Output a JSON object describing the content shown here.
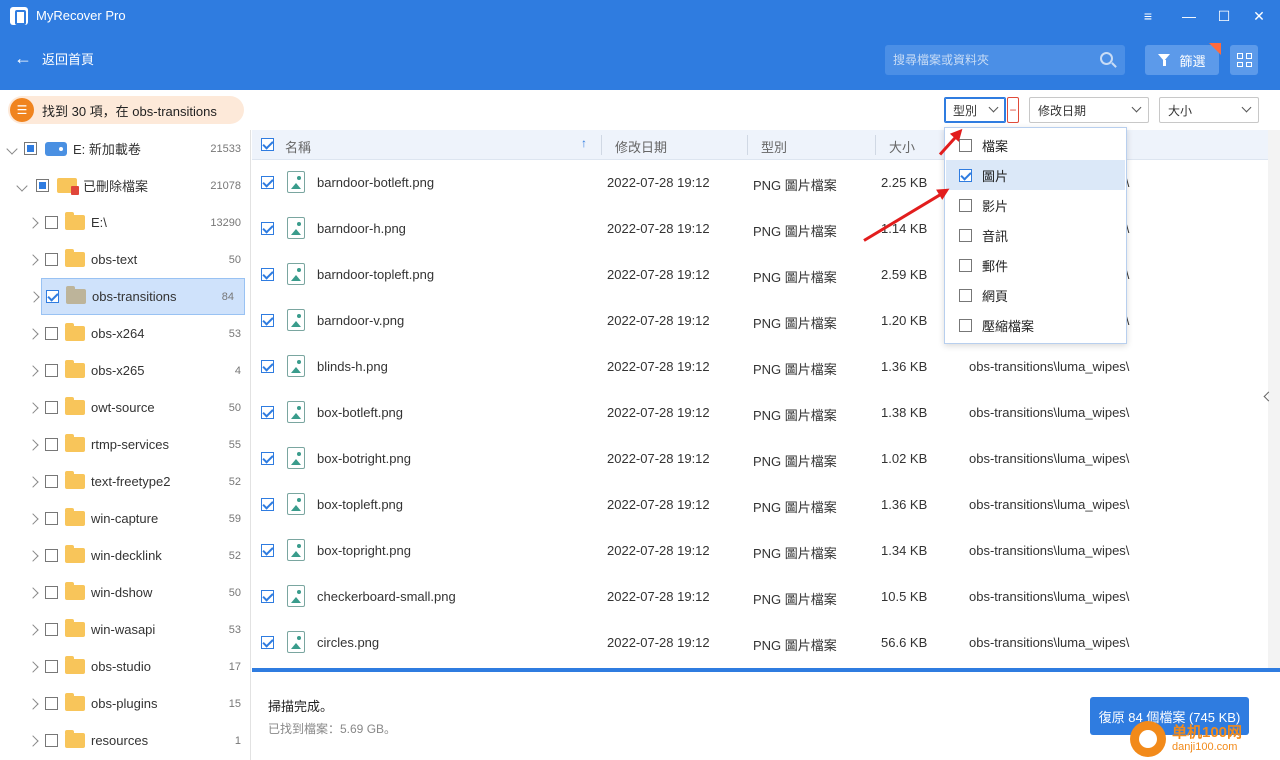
{
  "window": {
    "title": "MyRecover Pro",
    "controls": [
      "≡",
      "—",
      "☐",
      "✕"
    ]
  },
  "header": {
    "back_label": "返回首頁",
    "search_placeholder": "搜尋檔案或資料夾",
    "filter_label": "篩選"
  },
  "status": {
    "found_text": "找到 30 項，在 obs-transitions"
  },
  "filters": {
    "type_label": "型別",
    "clear_label": "−",
    "date_label": "修改日期",
    "size_label": "大小",
    "type_options": [
      {
        "label": "檔案",
        "checked": false
      },
      {
        "label": "圖片",
        "checked": true
      },
      {
        "label": "影片",
        "checked": false
      },
      {
        "label": "音訊",
        "checked": false
      },
      {
        "label": "郵件",
        "checked": false
      },
      {
        "label": "網頁",
        "checked": false
      },
      {
        "label": "壓縮檔案",
        "checked": false
      }
    ]
  },
  "tree": {
    "drive": {
      "label": "E: 新加載卷",
      "count": "21533"
    },
    "deleted": {
      "label": "已刪除檔案",
      "count": "21078"
    },
    "folders": [
      {
        "label": "E:\\",
        "count": "13290",
        "checked": false
      },
      {
        "label": "obs-text",
        "count": "50",
        "checked": false
      },
      {
        "label": "obs-transitions",
        "count": "84",
        "checked": true
      },
      {
        "label": "obs-x264",
        "count": "53",
        "checked": false
      },
      {
        "label": "obs-x265",
        "count": "4",
        "checked": false
      },
      {
        "label": "owt-source",
        "count": "50",
        "checked": false
      },
      {
        "label": "rtmp-services",
        "count": "55",
        "checked": false
      },
      {
        "label": "text-freetype2",
        "count": "52",
        "checked": false
      },
      {
        "label": "win-capture",
        "count": "59",
        "checked": false
      },
      {
        "label": "win-decklink",
        "count": "52",
        "checked": false
      },
      {
        "label": "win-dshow",
        "count": "50",
        "checked": false
      },
      {
        "label": "win-wasapi",
        "count": "53",
        "checked": false
      },
      {
        "label": "obs-studio",
        "count": "17",
        "checked": false
      },
      {
        "label": "obs-plugins",
        "count": "15",
        "checked": false
      },
      {
        "label": "resources",
        "count": "1",
        "checked": false
      }
    ]
  },
  "table": {
    "headers": {
      "name": "名稱",
      "date": "修改日期",
      "type": "型別",
      "size": "大小"
    },
    "rows": [
      {
        "name": "barndoor-botleft.png",
        "date": "2022-07-28 19:12",
        "type": "PNG 圖片檔案",
        "size": "2.25 KB",
        "path": "obs-transitions\\luma_wipes\\"
      },
      {
        "name": "barndoor-h.png",
        "date": "2022-07-28 19:12",
        "type": "PNG 圖片檔案",
        "size": "1.14 KB",
        "path": "obs-transitions\\luma_wipes\\"
      },
      {
        "name": "barndoor-topleft.png",
        "date": "2022-07-28 19:12",
        "type": "PNG 圖片檔案",
        "size": "2.59 KB",
        "path": "obs-transitions\\luma_wipes\\"
      },
      {
        "name": "barndoor-v.png",
        "date": "2022-07-28 19:12",
        "type": "PNG 圖片檔案",
        "size": "1.20 KB",
        "path": "obs-transitions\\luma_wipes\\"
      },
      {
        "name": "blinds-h.png",
        "date": "2022-07-28 19:12",
        "type": "PNG 圖片檔案",
        "size": "1.36 KB",
        "path": "obs-transitions\\luma_wipes\\"
      },
      {
        "name": "box-botleft.png",
        "date": "2022-07-28 19:12",
        "type": "PNG 圖片檔案",
        "size": "1.38 KB",
        "path": "obs-transitions\\luma_wipes\\"
      },
      {
        "name": "box-botright.png",
        "date": "2022-07-28 19:12",
        "type": "PNG 圖片檔案",
        "size": "1.02 KB",
        "path": "obs-transitions\\luma_wipes\\"
      },
      {
        "name": "box-topleft.png",
        "date": "2022-07-28 19:12",
        "type": "PNG 圖片檔案",
        "size": "1.36 KB",
        "path": "obs-transitions\\luma_wipes\\"
      },
      {
        "name": "box-topright.png",
        "date": "2022-07-28 19:12",
        "type": "PNG 圖片檔案",
        "size": "1.34 KB",
        "path": "obs-transitions\\luma_wipes\\"
      },
      {
        "name": "checkerboard-small.png",
        "date": "2022-07-28 19:12",
        "type": "PNG 圖片檔案",
        "size": "10.5 KB",
        "path": "obs-transitions\\luma_wipes\\"
      },
      {
        "name": "circles.png",
        "date": "2022-07-28 19:12",
        "type": "PNG 圖片檔案",
        "size": "56.6 KB",
        "path": "obs-transitions\\luma_wipes\\"
      }
    ]
  },
  "footer": {
    "status": "掃描完成。",
    "found": "已找到檔案：5.69 GB。",
    "recover_button": "復原 84 個檔案 (745 KB)"
  },
  "watermark": {
    "line1": "单机100网",
    "line2": "danji100.com"
  },
  "colors": {
    "accent": "#2f7ce0",
    "header_bg": "#2f7ce0",
    "annotation_arrow": "#e21d1d"
  }
}
